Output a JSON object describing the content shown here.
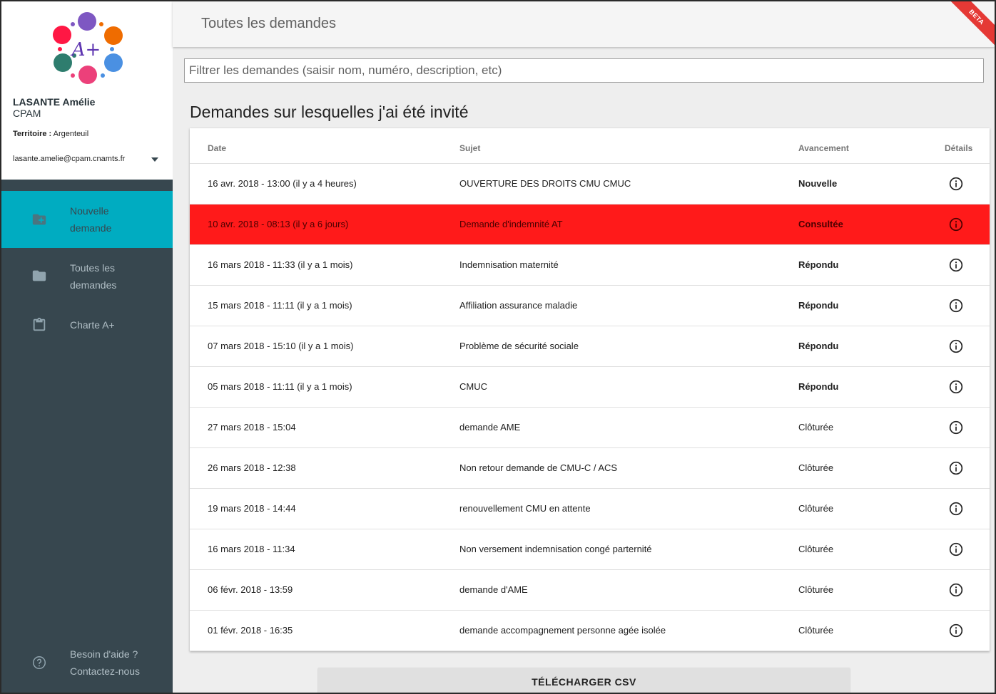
{
  "brand": {
    "logo_text": "A+"
  },
  "user": {
    "name": "LASANTE Amélie",
    "org": "CPAM",
    "territory_label": "Territoire :",
    "territory_value": "Argenteuil",
    "email": "lasante.amelie@cpam.cnamts.fr"
  },
  "nav": {
    "items": [
      {
        "label_line1": "Nouvelle",
        "label_line2": "demande",
        "icon": "folder-plus-icon"
      },
      {
        "label_line1": "Toutes les",
        "label_line2": "demandes",
        "icon": "folder-icon"
      },
      {
        "label": "Charte A+",
        "icon": "clipboard-icon"
      }
    ],
    "help_line1": "Besoin d'aide ?",
    "help_line2": "Contactez-nous"
  },
  "header": {
    "title": "Toutes les demandes",
    "beta": "BETA"
  },
  "filter": {
    "placeholder": "Filtrer les demandes (saisir nom, numéro, description, etc)",
    "value": ""
  },
  "section_title": "Demandes sur lesquelles j'ai été invité",
  "table": {
    "columns": [
      "Date",
      "Sujet",
      "Avancement",
      "Détails"
    ],
    "rows": [
      {
        "date": "16 avr. 2018 - 13:00 (il y a 4 heures)",
        "subject": "OUVERTURE DES DROITS CMU CMUC",
        "status": "Nouvelle"
      },
      {
        "date": "10 avr. 2018 - 08:13 (il y a 6 jours)",
        "subject": "Demande d'indemnité AT",
        "status": "Consultée"
      },
      {
        "date": "16 mars 2018 - 11:33 (il y a 1 mois)",
        "subject": "Indemnisation maternité",
        "status": "Répondu"
      },
      {
        "date": "15 mars 2018 - 11:11 (il y a 1 mois)",
        "subject": "Affiliation assurance maladie",
        "status": "Répondu"
      },
      {
        "date": "07 mars 2018 - 15:10 (il y a 1 mois)",
        "subject": "Problème de sécurité sociale",
        "status": "Répondu"
      },
      {
        "date": "05 mars 2018 - 11:11 (il y a 1 mois)",
        "subject": "CMUC",
        "status": "Répondu"
      },
      {
        "date": "27 mars 2018 - 15:04",
        "subject": "demande AME",
        "status": "Clôturée"
      },
      {
        "date": "26 mars 2018 - 12:38",
        "subject": "Non retour demande de CMU-C / ACS",
        "status": "Clôturée"
      },
      {
        "date": "19 mars 2018 - 14:44",
        "subject": "renouvellement CMU en attente",
        "status": "Clôturée"
      },
      {
        "date": "16 mars 2018 - 11:34",
        "subject": "Non versement indemnisation congé parternité",
        "status": "Clôturée"
      },
      {
        "date": "06 févr. 2018 - 13:59",
        "subject": "demande d'AME",
        "status": "Clôturée"
      },
      {
        "date": "01 févr. 2018 - 16:35",
        "subject": "demande accompagnement personne agée isolée",
        "status": "Clôturée"
      }
    ]
  },
  "csv_button": "TÉLÉCHARGER CSV",
  "colors": {
    "accent": "#00acc1",
    "sidebar": "#37474f",
    "highlight": "#ff1a1a"
  }
}
